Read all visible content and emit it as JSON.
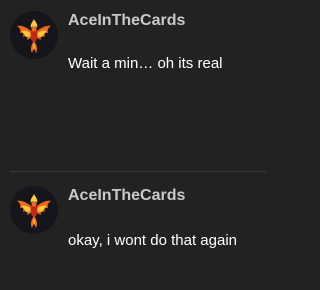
{
  "messages": [
    {
      "username": "AceInTheCards",
      "text": "Wait a min… oh its real",
      "avatar_icon": "phoenix-icon"
    },
    {
      "username": "AceInTheCards",
      "text": "okay, i wont do that again",
      "avatar_icon": "phoenix-icon"
    }
  ],
  "colors": {
    "background": "#222222",
    "username": "#c9c9c9",
    "message_text": "#ffffff",
    "divider": "#3a3a3a",
    "avatar_bg": "#15161c",
    "phoenix_orange": "#f26a1b",
    "phoenix_yellow": "#ffc93c",
    "phoenix_red": "#c0271a"
  }
}
